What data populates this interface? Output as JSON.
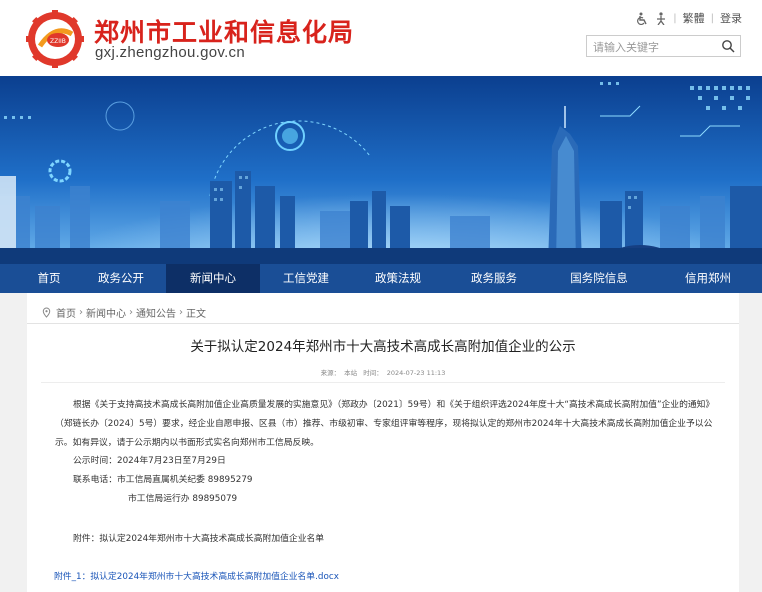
{
  "header": {
    "site_title": "郑州市工业和信息化局",
    "site_domain": "gxj.zhengzhou.gov.cn",
    "top_links": {
      "traditional": "繁體",
      "login": "登录"
    },
    "search": {
      "placeholder": "请输入关键字"
    }
  },
  "nav": {
    "items": [
      {
        "label": "首页"
      },
      {
        "label": "政务公开"
      },
      {
        "label": "新闻中心"
      },
      {
        "label": "工信党建"
      },
      {
        "label": "政策法规"
      },
      {
        "label": "政务服务"
      },
      {
        "label": "国务院信息"
      },
      {
        "label": "信用郑州"
      }
    ],
    "active_index": 2
  },
  "breadcrumb": {
    "items": [
      "首页",
      "新闻中心",
      "通知公告"
    ],
    "current": "正文"
  },
  "article": {
    "title": "关于拟认定2024年郑州市十大高技术高成长高附加值企业的公示",
    "source_label": "来源：",
    "source": "本站",
    "time_label": "时间：",
    "time": "2024-07-23 11:13",
    "paragraph": "根据《关于支持高技术高成长高附加值企业高质量发展的实施意见》（郑政办〔2021〕59号）和《关于组织评选2024年度十大“高技术高成长高附加值”企业的通知》（郑链长办〔2024〕5号）要求，经企业自愿申报、区县（市）推荐、市级初审、专家组评审等程序，现将拟认定的郑州市2024年十大高技术高成长高附加值企业予以公示。如有异议，请于公示期内以书面形式实名向郑州市工信局反映。",
    "period_line": "公示时间：2024年7月23日至7月29日",
    "contact_line1": "联系电话：市工信局直属机关纪委  89895279",
    "contact_line2": "市工信局运行办  89895079",
    "attachment_note": "附件：拟认定2024年郑州市十大高技术高成长高附加值企业名单",
    "attachment_link": "附件_1：拟认定2024年郑州市十大高技术高成长高附加值企业名单.docx"
  },
  "colors": {
    "brand_red": "#d8231c",
    "nav_blue": "#1a4e96",
    "nav_active": "#0d2f66",
    "link_blue": "#1a55b8"
  }
}
